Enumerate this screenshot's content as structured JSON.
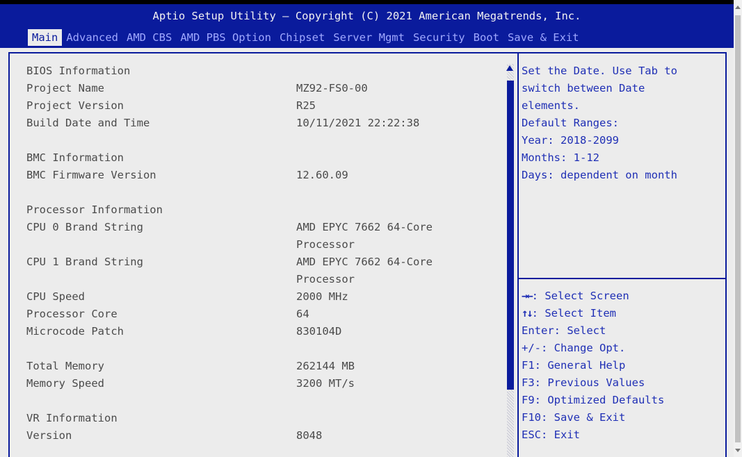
{
  "title": "Aptio Setup Utility – Copyright (C) 2021 American Megatrends, Inc.",
  "tabs": [
    "Main",
    "Advanced",
    "AMD CBS",
    "AMD PBS Option",
    "Chipset",
    "Server Mgmt",
    "Security",
    "Boot",
    "Save & Exit"
  ],
  "active_tab": "Main",
  "info": {
    "bios_header": "BIOS Information",
    "project_name_label": "Project Name",
    "project_name_value": "MZ92-FS0-00",
    "project_version_label": "Project Version",
    "project_version_value": "R25",
    "build_date_label": "Build Date and Time",
    "build_date_value": "10/11/2021 22:22:38",
    "bmc_header": "BMC Information",
    "bmc_fw_label": "BMC Firmware Version",
    "bmc_fw_value": "12.60.09",
    "proc_header": "Processor Information",
    "cpu0_label": "CPU 0 Brand String",
    "cpu0_value_line1": "AMD EPYC 7662 64-Core",
    "cpu0_value_line2": "Processor",
    "cpu1_label": "CPU 1 Brand String",
    "cpu1_value_line1": "AMD EPYC 7662 64-Core",
    "cpu1_value_line2": "Processor",
    "cpu_speed_label": "CPU Speed",
    "cpu_speed_value": "2000 MHz",
    "proc_core_label": "Processor Core",
    "proc_core_value": "64",
    "microcode_label": "Microcode Patch",
    "microcode_value": "830104D",
    "total_mem_label": "Total Memory",
    "total_mem_value": "262144 MB",
    "mem_speed_label": "Memory Speed",
    "mem_speed_value": "3200 MT/s",
    "vr_header": "VR Information",
    "version_label": "Version",
    "version_value": "8048"
  },
  "help": {
    "lines": [
      "Set the Date. Use Tab to",
      "switch between Date",
      "elements.",
      "Default Ranges:",
      "Year: 2018-2099",
      "Months: 1-12",
      "Days: dependent on month"
    ]
  },
  "keys": {
    "select_screen": ": Select Screen",
    "select_item": ": Select Item",
    "enter": "Enter: Select",
    "change": "+/-: Change Opt.",
    "f1": "F1: General Help",
    "f3": "F3: Previous Values",
    "f9": "F9: Optimized Defaults",
    "f10": "F10: Save & Exit",
    "esc": "ESC: Exit"
  },
  "colors": {
    "accent": "#0a1b9c",
    "background": "#ececec",
    "help_text": "#1f2fb5"
  }
}
